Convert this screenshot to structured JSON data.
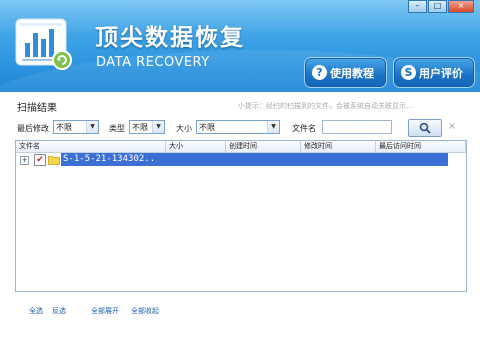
{
  "window": {
    "minimize": "–",
    "maximize": "□",
    "close": "×"
  },
  "header": {
    "title": "顶尖数据恢复",
    "subtitle": "DATA RECOVERY",
    "tutorial_button": "使用教程",
    "tutorial_icon": "?",
    "review_button": "用户评价",
    "review_icon": "S"
  },
  "section": {
    "title": "扫描结果",
    "tip": "小提示：经扫的扫描到的文件，会被系统自动关联显示..."
  },
  "filters": {
    "modified_label": "最后修改",
    "modified_value": "不限",
    "type_label": "类型",
    "type_value": "不限",
    "size_label": "大小",
    "size_value": "不限",
    "filename_label": "文件名",
    "filename_value": "",
    "clear_icon": "×"
  },
  "grid": {
    "columns": [
      "文件名",
      "大小",
      "创建时间",
      "修改时间",
      "最后访问时间"
    ],
    "rows": [
      {
        "expander": "+",
        "checked": "✔",
        "name": "S-1-5-21-134302.."
      }
    ]
  },
  "footer": {
    "select_all": "全选",
    "invert": "反选",
    "expand_all": "全部展开",
    "collapse_all": "全部收起"
  },
  "colors": {
    "header_top": "#7fc8f3",
    "header_bottom": "#1c86d8",
    "selection": "#3b6fd4",
    "link": "#1a5fb4"
  }
}
